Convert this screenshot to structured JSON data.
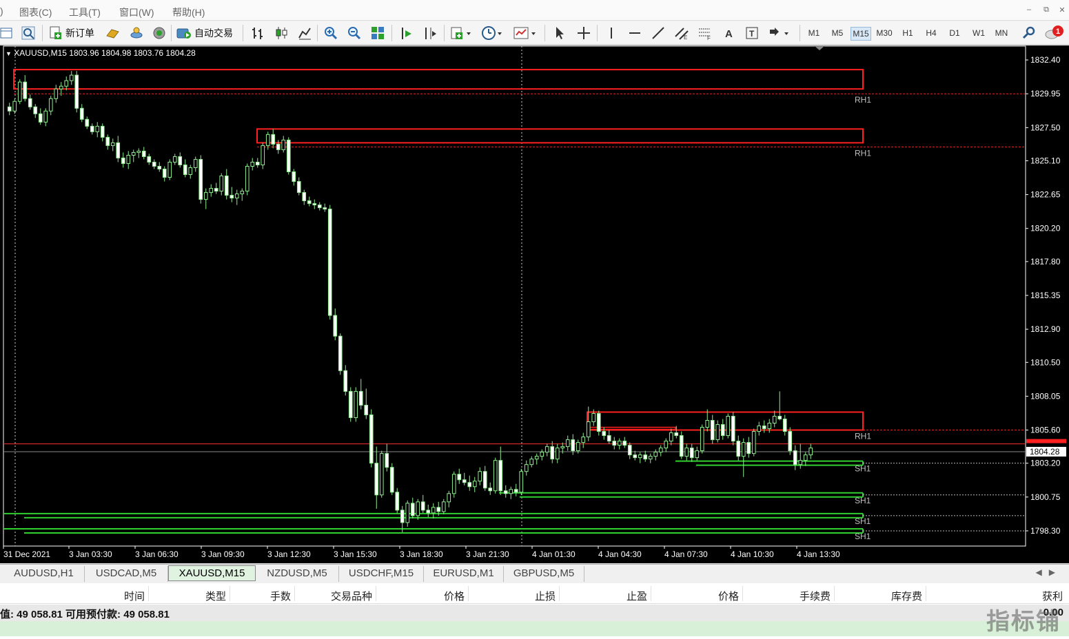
{
  "menu": {
    "items": [
      ")",
      "图表(C)",
      "工具(T)",
      "窗口(W)",
      "帮助(H)"
    ]
  },
  "toolbar": {
    "new_order_label": "新订单",
    "auto_trade_label": "自动交易",
    "timeframes": [
      "M1",
      "M5",
      "M15",
      "M30",
      "H1",
      "H4",
      "D1",
      "W1",
      "MN"
    ],
    "active_timeframe": "M15",
    "notification_count": "1"
  },
  "chart": {
    "header": "XAUUSD,M15  1803.96 1804.98 1803.76 1804.28",
    "current_price_label": "1804.28",
    "colors": {
      "background": "#000000",
      "bull": "#90ee90",
      "bear_fill": "#ffffff",
      "resistance": "#ff2020",
      "support": "#30d030",
      "axis_text": "#ffffff",
      "zone_label": "#c0c0c0"
    },
    "zone_labels": [
      "RH1",
      "RH1",
      "RH1",
      "SH1",
      "SH1",
      "SH1",
      "SH1"
    ]
  },
  "chart_data": {
    "type": "candlestick",
    "symbol": "XAUUSD",
    "timeframe": "M15",
    "ylim": [
      1797.2,
      1833.4
    ],
    "y_ticks": [
      1832.4,
      1829.95,
      1827.5,
      1825.1,
      1822.65,
      1820.2,
      1817.8,
      1815.35,
      1812.9,
      1810.5,
      1808.05,
      1805.6,
      1803.2,
      1800.75,
      1798.3
    ],
    "x_ticks": [
      "31 Dec 2021",
      "3 Jan 03:30",
      "3 Jan 06:30",
      "3 Jan 09:30",
      "3 Jan 12:30",
      "3 Jan 15:30",
      "3 Jan 18:30",
      "3 Jan 21:30",
      "4 Jan 01:30",
      "4 Jan 04:30",
      "4 Jan 07:30",
      "4 Jan 10:30",
      "4 Jan 13:30"
    ],
    "current_price": 1804.28,
    "bid_line": 1804.6,
    "resistance_zones": [
      {
        "label": "RH1",
        "top": 1831.7,
        "bottom": 1830.3,
        "level": 1829.95
      },
      {
        "label": "RH1",
        "top": 1827.4,
        "bottom": 1826.4,
        "level": 1826.1
      },
      {
        "label": "RH1",
        "top": 1806.9,
        "bottom": 1805.6,
        "level": 1805.6
      }
    ],
    "support_zones": [
      {
        "label": "SH1",
        "level": 1803.2
      },
      {
        "label": "SH1",
        "level": 1800.9
      },
      {
        "label": "SH1",
        "level": 1799.4
      },
      {
        "label": "SH1",
        "level": 1798.3
      }
    ],
    "candles": [
      [
        1829.0,
        1829.3,
        1828.4,
        1828.7
      ],
      [
        1828.7,
        1829.6,
        1828.5,
        1829.4
      ],
      [
        1829.4,
        1831.0,
        1829.2,
        1830.8
      ],
      [
        1830.8,
        1831.3,
        1829.4,
        1829.6
      ],
      [
        1829.6,
        1829.9,
        1828.8,
        1829.0
      ],
      [
        1829.0,
        1829.2,
        1828.2,
        1828.5
      ],
      [
        1828.5,
        1828.9,
        1827.7,
        1827.9
      ],
      [
        1827.9,
        1828.9,
        1827.6,
        1828.7
      ],
      [
        1828.7,
        1829.8,
        1828.4,
        1829.6
      ],
      [
        1829.6,
        1830.6,
        1829.3,
        1830.3
      ],
      [
        1830.3,
        1830.8,
        1829.8,
        1830.5
      ],
      [
        1830.5,
        1831.2,
        1830.2,
        1830.9
      ],
      [
        1830.9,
        1831.6,
        1830.6,
        1831.3
      ],
      [
        1831.3,
        1831.6,
        1828.6,
        1828.9
      ],
      [
        1828.9,
        1829.2,
        1827.9,
        1828.1
      ],
      [
        1828.1,
        1828.3,
        1827.4,
        1827.6
      ],
      [
        1827.6,
        1827.8,
        1827.0,
        1827.2
      ],
      [
        1827.2,
        1827.9,
        1826.8,
        1827.6
      ],
      [
        1827.6,
        1827.8,
        1826.5,
        1826.8
      ],
      [
        1826.8,
        1827.0,
        1825.9,
        1826.2
      ],
      [
        1826.2,
        1826.7,
        1825.8,
        1826.4
      ],
      [
        1826.4,
        1826.9,
        1825.0,
        1825.3
      ],
      [
        1825.3,
        1825.7,
        1824.6,
        1824.9
      ],
      [
        1824.9,
        1825.8,
        1824.5,
        1825.5
      ],
      [
        1825.5,
        1825.9,
        1825.0,
        1825.7
      ],
      [
        1825.7,
        1826.0,
        1825.3,
        1825.8
      ],
      [
        1825.8,
        1826.1,
        1825.2,
        1825.4
      ],
      [
        1825.4,
        1825.6,
        1824.8,
        1825.0
      ],
      [
        1825.0,
        1825.2,
        1824.5,
        1824.7
      ],
      [
        1824.7,
        1825.0,
        1824.3,
        1824.5
      ],
      [
        1824.5,
        1824.7,
        1823.6,
        1823.9
      ],
      [
        1823.9,
        1825.2,
        1823.7,
        1825.0
      ],
      [
        1825.0,
        1825.6,
        1824.8,
        1825.4
      ],
      [
        1825.4,
        1825.7,
        1824.6,
        1824.8
      ],
      [
        1824.8,
        1825.2,
        1823.9,
        1824.1
      ],
      [
        1824.1,
        1824.8,
        1823.8,
        1824.6
      ],
      [
        1824.6,
        1825.4,
        1824.3,
        1825.2
      ],
      [
        1825.2,
        1825.5,
        1822.0,
        1822.3
      ],
      [
        1822.3,
        1823.1,
        1821.6,
        1822.8
      ],
      [
        1822.8,
        1823.4,
        1822.5,
        1823.1
      ],
      [
        1823.1,
        1823.5,
        1822.7,
        1822.9
      ],
      [
        1822.9,
        1824.2,
        1822.6,
        1824.0
      ],
      [
        1824.0,
        1824.5,
        1822.3,
        1822.6
      ],
      [
        1822.6,
        1823.2,
        1822.1,
        1822.4
      ],
      [
        1822.4,
        1823.0,
        1821.9,
        1822.7
      ],
      [
        1822.7,
        1823.1,
        1822.2,
        1822.9
      ],
      [
        1822.9,
        1824.9,
        1822.6,
        1824.7
      ],
      [
        1824.7,
        1825.3,
        1824.4,
        1825.0
      ],
      [
        1825.0,
        1825.3,
        1824.6,
        1824.8
      ],
      [
        1824.8,
        1826.4,
        1824.5,
        1826.2
      ],
      [
        1826.2,
        1827.2,
        1825.9,
        1827.0
      ],
      [
        1827.0,
        1827.4,
        1826.0,
        1826.3
      ],
      [
        1826.3,
        1826.6,
        1825.6,
        1825.9
      ],
      [
        1825.9,
        1826.9,
        1825.7,
        1826.6
      ],
      [
        1826.6,
        1826.8,
        1824.1,
        1824.3
      ],
      [
        1824.3,
        1824.5,
        1823.3,
        1823.6
      ],
      [
        1823.6,
        1823.9,
        1822.6,
        1822.8
      ],
      [
        1822.8,
        1823.0,
        1821.9,
        1822.2
      ],
      [
        1822.2,
        1822.5,
        1821.8,
        1822.0
      ],
      [
        1822.0,
        1822.3,
        1821.6,
        1821.9
      ],
      [
        1821.9,
        1822.1,
        1821.5,
        1821.7
      ],
      [
        1821.7,
        1822.0,
        1821.4,
        1821.6
      ],
      [
        1821.6,
        1821.9,
        1813.6,
        1813.9
      ],
      [
        1813.9,
        1814.4,
        1812.1,
        1812.4
      ],
      [
        1812.4,
        1812.6,
        1809.6,
        1809.9
      ],
      [
        1809.9,
        1810.3,
        1808.1,
        1808.4
      ],
      [
        1808.4,
        1808.7,
        1806.2,
        1806.5
      ],
      [
        1806.5,
        1808.7,
        1806.2,
        1808.4
      ],
      [
        1808.4,
        1809.3,
        1807.1,
        1807.4
      ],
      [
        1807.4,
        1808.6,
        1806.4,
        1806.7
      ],
      [
        1806.7,
        1807.1,
        1802.9,
        1803.2
      ],
      [
        1803.2,
        1804.4,
        1799.9,
        1800.9
      ],
      [
        1800.9,
        1804.1,
        1800.7,
        1803.9
      ],
      [
        1803.9,
        1804.6,
        1802.6,
        1802.9
      ],
      [
        1802.9,
        1803.2,
        1800.9,
        1801.1
      ],
      [
        1801.1,
        1801.4,
        1799.6,
        1799.8
      ],
      [
        1799.8,
        1800.1,
        1798.2,
        1798.9
      ],
      [
        1798.9,
        1800.5,
        1798.6,
        1800.3
      ],
      [
        1800.3,
        1800.7,
        1799.2,
        1799.4
      ],
      [
        1799.4,
        1800.6,
        1799.1,
        1800.4
      ],
      [
        1800.4,
        1800.9,
        1799.6,
        1799.8
      ],
      [
        1799.8,
        1800.2,
        1799.3,
        1799.6
      ],
      [
        1799.6,
        1800.3,
        1799.2,
        1800.0
      ],
      [
        1800.0,
        1800.4,
        1799.4,
        1799.7
      ],
      [
        1799.7,
        1800.6,
        1799.5,
        1800.4
      ],
      [
        1800.4,
        1801.2,
        1800.0,
        1801.0
      ],
      [
        1801.0,
        1802.6,
        1800.7,
        1802.4
      ],
      [
        1802.4,
        1802.8,
        1801.7,
        1802.0
      ],
      [
        1802.0,
        1802.5,
        1801.6,
        1801.8
      ],
      [
        1801.8,
        1802.3,
        1801.2,
        1801.5
      ],
      [
        1801.5,
        1802.2,
        1801.1,
        1801.9
      ],
      [
        1801.9,
        1802.9,
        1801.6,
        1802.6
      ],
      [
        1802.6,
        1803.0,
        1801.2,
        1801.4
      ],
      [
        1801.4,
        1801.8,
        1800.9,
        1801.2
      ],
      [
        1801.2,
        1803.6,
        1801.0,
        1803.4
      ],
      [
        1803.4,
        1804.4,
        1800.9,
        1801.2
      ],
      [
        1801.2,
        1801.6,
        1800.7,
        1801.0
      ],
      [
        1801.0,
        1801.5,
        1800.6,
        1801.3
      ],
      [
        1801.3,
        1801.7,
        1800.8,
        1801.1
      ],
      [
        1801.1,
        1802.8,
        1800.9,
        1802.6
      ],
      [
        1802.6,
        1803.4,
        1802.3,
        1803.1
      ],
      [
        1803.1,
        1803.7,
        1802.9,
        1803.5
      ],
      [
        1803.5,
        1803.9,
        1803.1,
        1803.7
      ],
      [
        1803.7,
        1804.2,
        1803.4,
        1804.0
      ],
      [
        1804.0,
        1804.6,
        1803.7,
        1804.4
      ],
      [
        1804.4,
        1804.8,
        1803.2,
        1803.5
      ],
      [
        1803.5,
        1804.6,
        1803.2,
        1804.3
      ],
      [
        1804.3,
        1804.7,
        1803.9,
        1804.4
      ],
      [
        1804.4,
        1805.2,
        1804.1,
        1804.9
      ],
      [
        1804.9,
        1805.3,
        1803.8,
        1804.1
      ],
      [
        1804.1,
        1804.9,
        1803.9,
        1804.7
      ],
      [
        1804.7,
        1805.4,
        1804.3,
        1805.1
      ],
      [
        1805.1,
        1807.3,
        1804.8,
        1806.2
      ],
      [
        1806.2,
        1807.1,
        1805.9,
        1806.8
      ],
      [
        1806.8,
        1807.0,
        1805.2,
        1805.5
      ],
      [
        1805.5,
        1805.8,
        1804.9,
        1805.2
      ],
      [
        1805.2,
        1805.6,
        1804.6,
        1804.8
      ],
      [
        1804.8,
        1805.1,
        1804.2,
        1804.5
      ],
      [
        1804.5,
        1805.0,
        1804.2,
        1804.8
      ],
      [
        1804.8,
        1805.1,
        1804.3,
        1804.5
      ],
      [
        1804.5,
        1804.7,
        1803.5,
        1803.8
      ],
      [
        1803.8,
        1804.1,
        1803.4,
        1803.6
      ],
      [
        1803.6,
        1804.0,
        1803.2,
        1803.8
      ],
      [
        1803.8,
        1804.1,
        1803.3,
        1803.5
      ],
      [
        1803.5,
        1803.9,
        1803.2,
        1803.7
      ],
      [
        1803.7,
        1804.2,
        1803.4,
        1804.0
      ],
      [
        1804.0,
        1804.5,
        1803.7,
        1804.3
      ],
      [
        1804.3,
        1805.0,
        1804.0,
        1804.8
      ],
      [
        1804.8,
        1805.7,
        1804.5,
        1805.4
      ],
      [
        1805.4,
        1805.9,
        1805.0,
        1805.2
      ],
      [
        1805.2,
        1805.5,
        1803.5,
        1803.7
      ],
      [
        1803.7,
        1804.6,
        1803.4,
        1804.3
      ],
      [
        1804.3,
        1804.6,
        1803.3,
        1803.6
      ],
      [
        1803.6,
        1804.4,
        1803.4,
        1804.1
      ],
      [
        1804.1,
        1806.0,
        1803.9,
        1805.8
      ],
      [
        1805.8,
        1807.1,
        1805.5,
        1806.3
      ],
      [
        1806.3,
        1806.7,
        1804.6,
        1804.9
      ],
      [
        1804.9,
        1806.3,
        1804.7,
        1806.0
      ],
      [
        1806.0,
        1806.4,
        1804.9,
        1805.2
      ],
      [
        1805.2,
        1806.8,
        1805.0,
        1806.6
      ],
      [
        1806.6,
        1806.9,
        1804.5,
        1804.8
      ],
      [
        1804.8,
        1805.2,
        1803.4,
        1803.7
      ],
      [
        1803.7,
        1805.0,
        1802.2,
        1804.7
      ],
      [
        1804.7,
        1805.1,
        1803.6,
        1803.9
      ],
      [
        1803.9,
        1805.7,
        1803.7,
        1805.5
      ],
      [
        1805.5,
        1806.2,
        1805.2,
        1805.9
      ],
      [
        1805.9,
        1806.3,
        1805.4,
        1805.7
      ],
      [
        1805.7,
        1806.4,
        1805.4,
        1806.1
      ],
      [
        1806.1,
        1807.0,
        1805.8,
        1806.6
      ],
      [
        1806.6,
        1808.4,
        1806.3,
        1806.4
      ],
      [
        1806.4,
        1806.7,
        1805.2,
        1805.5
      ],
      [
        1805.5,
        1805.8,
        1803.8,
        1804.1
      ],
      [
        1804.1,
        1804.5,
        1802.7,
        1803.1
      ],
      [
        1803.1,
        1804.6,
        1802.8,
        1803.4
      ],
      [
        1803.4,
        1804.0,
        1803.0,
        1803.8
      ],
      [
        1803.8,
        1804.6,
        1803.5,
        1804.3
      ]
    ]
  },
  "symbol_tabs": {
    "items": [
      "AUDUSD,H1",
      "USDCAD,M5",
      "XAUUSD,M15",
      "NZDUSD,M5",
      "USDCHF,M15",
      "EURUSD,M1",
      "GBPUSD,M5"
    ],
    "active": "XAUUSD,M15"
  },
  "orders": {
    "columns": [
      "时间",
      "类型",
      "手数",
      "交易品种",
      "价格",
      "止损",
      "止盈",
      "价格",
      "手续费",
      "库存费",
      "获利"
    ],
    "balance_text": "值: 49 058.81  可用预付款: 49 058.81",
    "profit_value": "0.00",
    "watermark": "指标铺"
  }
}
